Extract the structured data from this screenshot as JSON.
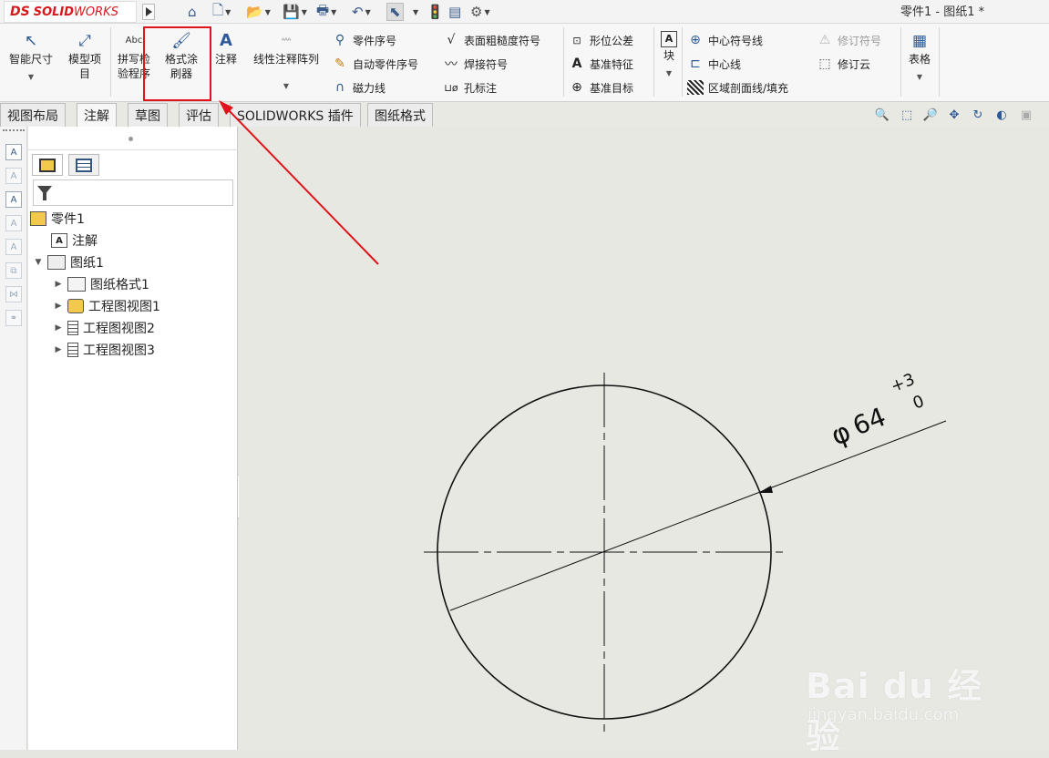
{
  "titlebar": {
    "logo": {
      "ds": "DS",
      "solid": "SOLID",
      "works": "WORKS"
    },
    "doc_title": "零件1 - 图纸1 *"
  },
  "ribbon": {
    "smart_dimension": "智能尺寸",
    "model_items_line1": "模型项",
    "model_items_line2": "目",
    "spell_check_icon_text": "Abc",
    "spell_check_line1": "拼写检",
    "spell_check_line2": "验程序",
    "format_painter_line1": "格式涂",
    "format_painter_line2": "刷器",
    "note": "注释",
    "linear_note_pattern": "线性注释阵列",
    "balloon": "零件序号",
    "auto_balloon": "自动零件序号",
    "magnetic_line": "磁力线",
    "surface_finish": "表面粗糙度符号",
    "weld_symbol": "焊接符号",
    "hole_callout": "孔标注",
    "geometric_tolerance": "形位公差",
    "datum_feature": "基准特征",
    "datum_target": "基准目标",
    "blocks": "块",
    "center_mark": "中心符号线",
    "centerline": "中心线",
    "area_hatch": "区域剖面线/填充",
    "revision_symbol": "修订符号",
    "revision_cloud": "修订云",
    "tables": "表格"
  },
  "tabs": [
    {
      "label": "视图布局"
    },
    {
      "label": "注解"
    },
    {
      "label": "草图"
    },
    {
      "label": "评估"
    },
    {
      "label": "SOLIDWORKS 插件"
    },
    {
      "label": "图纸格式"
    }
  ],
  "tree": {
    "root": "零件1",
    "annotations": "注解",
    "sheet": "图纸1",
    "sheet_format": "图纸格式1",
    "view1": "工程图视图1",
    "view2": "工程图视图2",
    "view3": "工程图视图3"
  },
  "drawing": {
    "dimension_symbol": "φ",
    "dimension_value": "64",
    "upper_tolerance": "+3",
    "lower_tolerance": "0"
  },
  "watermark": {
    "main": "Bai du 经验",
    "sub": "jingyan.baidu.com"
  },
  "colors": {
    "highlight": "#e0141a",
    "brand_red": "#d5191c",
    "icon_blue": "#2d5a96",
    "canvas_bg": "#e8e8e2"
  }
}
